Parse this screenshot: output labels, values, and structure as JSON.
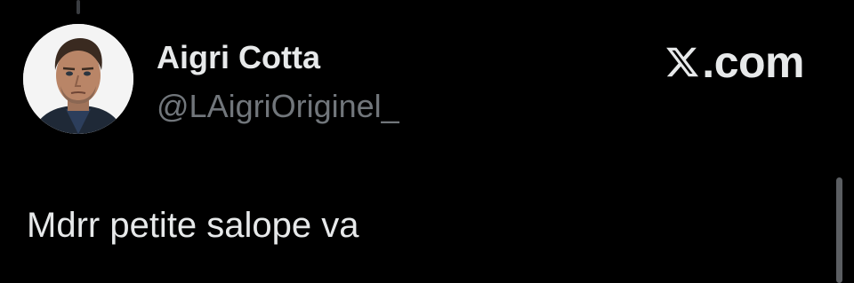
{
  "tweet": {
    "author_name": "Aigri Cotta",
    "author_handle": "@LAigriOriginel_",
    "text": "Mdrr petite salope va",
    "avatar_icon": "profile-photo"
  },
  "brand": {
    "icon": "x-logo-icon",
    "text": ".com"
  },
  "colors": {
    "background": "#000000",
    "primary_text": "#e7e9ea",
    "secondary_text": "#71767b"
  }
}
